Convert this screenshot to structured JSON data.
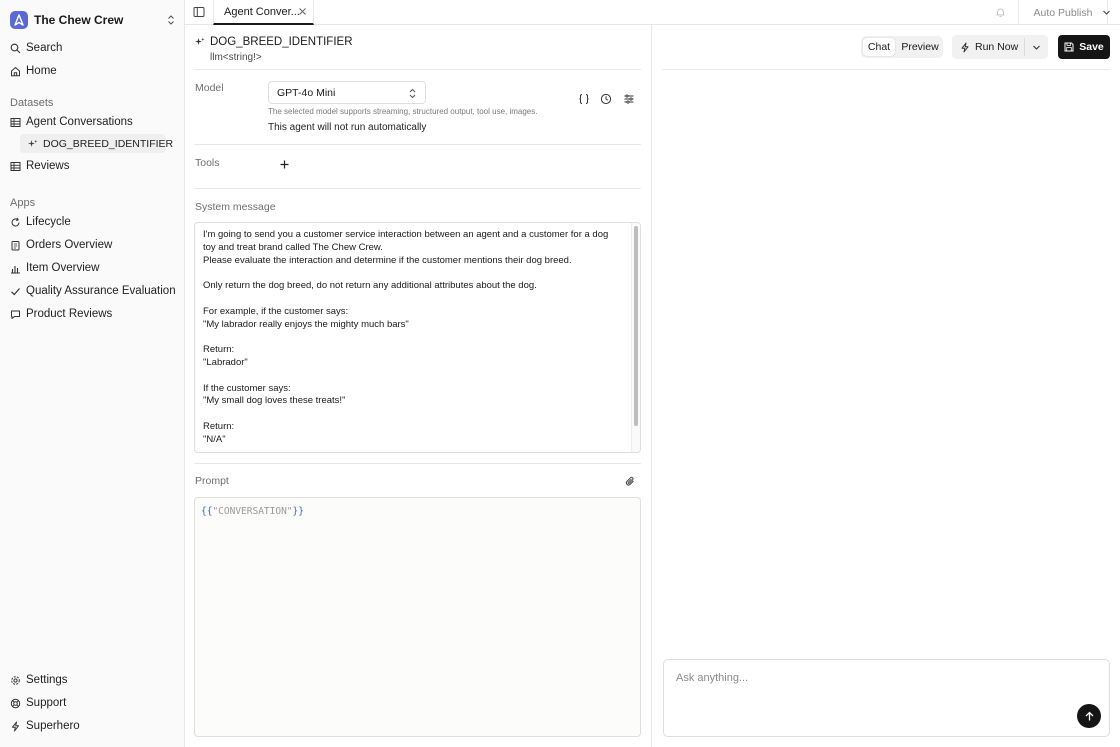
{
  "sidebar": {
    "workspace": "The Chew Crew",
    "search": "Search",
    "home": "Home",
    "datasets_label": "Datasets",
    "datasets": {
      "agent_conversations": "Agent Conversations",
      "dog_breed_identifier": "DOG_BREED_IDENTIFIER",
      "reviews": "Reviews"
    },
    "apps_label": "Apps",
    "apps": {
      "lifecycle": "Lifecycle",
      "orders_overview": "Orders Overview",
      "item_overview": "Item Overview",
      "quality_assurance": "Quality Assurance Evaluation",
      "product_reviews": "Product Reviews"
    },
    "footer": {
      "settings": "Settings",
      "support": "Support",
      "superhero": "Superhero"
    }
  },
  "tabbar": {
    "tab_label": "Agent Conver...",
    "auto_publish": "Auto Publish"
  },
  "editor": {
    "agent_name": "DOG_BREED_IDENTIFIER",
    "agent_type": "llm<string!>",
    "model_label": "Model",
    "model_value": "GPT-4o Mini",
    "model_note": "The selected model supports streaming, structured output, tool use, images.",
    "model_status": "This agent will not run automatically",
    "tools_label": "Tools",
    "system_label": "System message",
    "system_message": "I'm going to send you a customer service interaction between an agent and a customer for a dog toy and treat brand called The Chew Crew.\nPlease evaluate the interaction and determine if the customer mentions their dog breed.\n\nOnly return the dog breed, do not return any additional attributes about the dog.\n\nFor example, if the customer says:\n\"My labrador really enjoys the mighty much bars\"\n\nReturn:\n\"Labrador\"\n\nIf the customer says:\n\"My small dog loves these treats!\"\n\nReturn:\n\"N/A\"",
    "prompt_label": "Prompt",
    "prompt_open": "{{",
    "prompt_var": "\"CONVERSATION\"",
    "prompt_close": "}}"
  },
  "right": {
    "chat_tab": "Chat",
    "preview_tab": "Preview",
    "run_now": "Run Now",
    "save": "Save",
    "chat_placeholder": "Ask anything..."
  },
  "colors": {
    "accent": "#5c6ad6",
    "primary_button": "#151515",
    "prompt_brace": "#2a6bd8"
  }
}
